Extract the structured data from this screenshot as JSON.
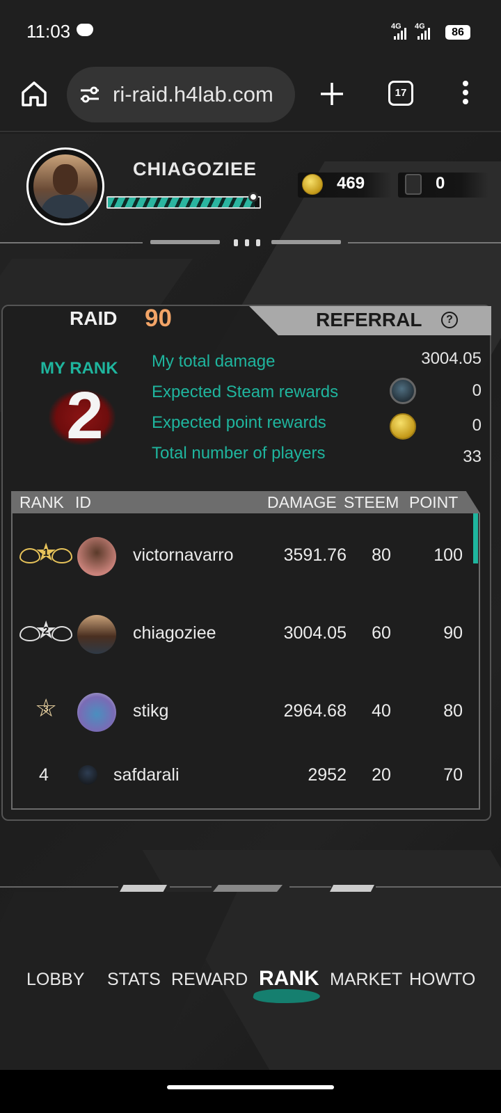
{
  "status_bar": {
    "time": "11:03",
    "signal1": "4G",
    "signal2": "4G",
    "battery": "86"
  },
  "browser": {
    "url": "ri-raid.h4lab.com",
    "tab_count": "17"
  },
  "profile": {
    "username": "CHIAGOZIEE",
    "xp_fraction": 0.97,
    "coins": "469",
    "steem": "0"
  },
  "tabs": {
    "raid_label": "RAID",
    "raid_number": "90",
    "referral_label": "REFERRAL",
    "help_glyph": "?"
  },
  "my_rank": {
    "label": "MY RANK",
    "value": "2"
  },
  "stats": [
    {
      "label": "My total damage",
      "value": "3004.05"
    },
    {
      "label": "Expected Steam rewards",
      "value": "0",
      "icon": "steem-icon"
    },
    {
      "label": "Expected point rewards",
      "value": "0",
      "icon": "coin-icon"
    },
    {
      "label": "Total number of players",
      "value": "33"
    }
  ],
  "table": {
    "headers": [
      "RANK",
      "ID",
      "DAMAGE",
      "STEEM",
      "POINT"
    ],
    "rows": [
      {
        "rank": "1",
        "id": "victornavarro",
        "damage": "3591.76",
        "steem": "80",
        "point": "100",
        "badge": "gold-wing-badge"
      },
      {
        "rank": "2",
        "id": "chiagoziee",
        "damage": "3004.05",
        "steem": "60",
        "point": "90",
        "badge": "silver-wing-badge"
      },
      {
        "rank": "3",
        "id": "stikg",
        "damage": "2964.68",
        "steem": "40",
        "point": "80",
        "badge": "bronze-star-badge"
      },
      {
        "rank": "4",
        "id": "safdarali",
        "damage": "2952",
        "steem": "20",
        "point": "70"
      }
    ]
  },
  "nav": {
    "items": [
      "LOBBY",
      "STATS",
      "REWARD",
      "RANK",
      "MARKET",
      "HOWTO"
    ],
    "active": "RANK"
  },
  "colors": {
    "accent_teal": "#1fb59e",
    "raid_orange": "#f2a467",
    "rank_red": "#8b1414"
  }
}
